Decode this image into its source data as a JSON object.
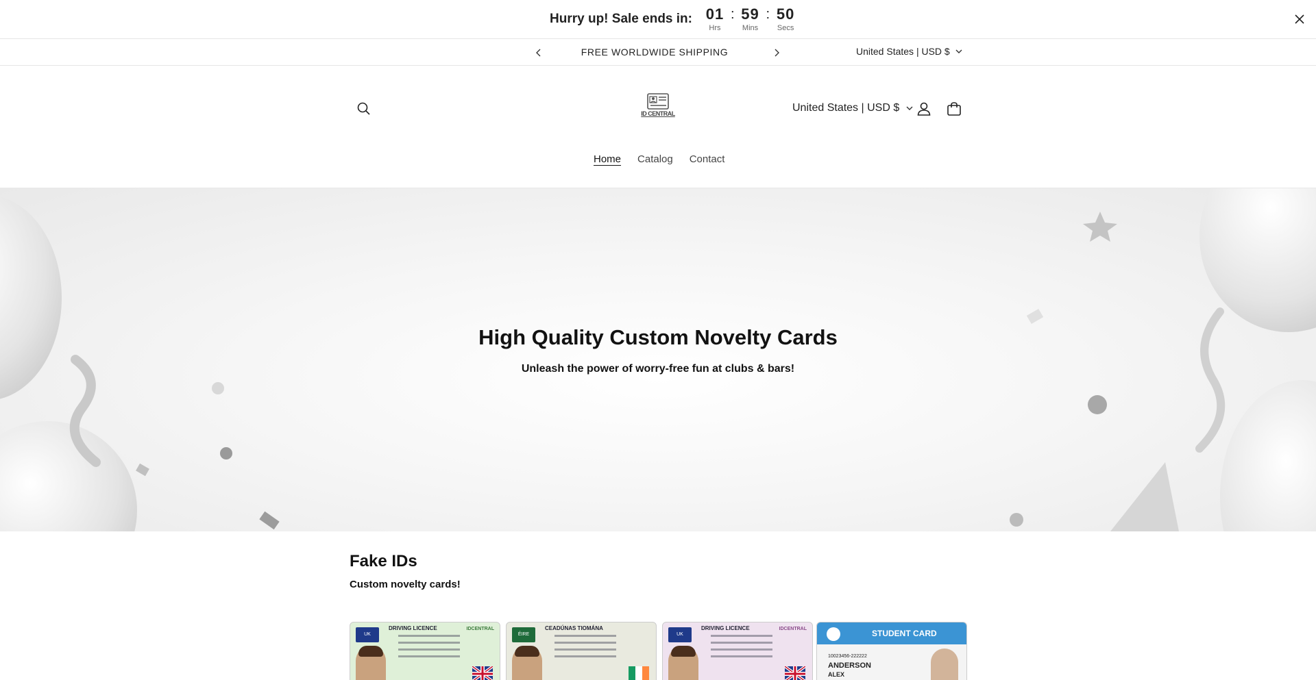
{
  "countdown": {
    "label": "Hurry up! Sale ends in:",
    "hours": "01",
    "hours_caption": "Hrs",
    "minutes": "59",
    "minutes_caption": "Mins",
    "seconds": "50",
    "seconds_caption": "Secs",
    "separator": ":"
  },
  "announcement": {
    "text": "FREE WORLDWIDE SHIPPING",
    "locale": "United States | USD $"
  },
  "header": {
    "logo_text": "ID CENTRAL",
    "locale": "United States | USD $",
    "nav": [
      {
        "label": "Home",
        "active": true
      },
      {
        "label": "Catalog",
        "active": false
      },
      {
        "label": "Contact",
        "active": false
      }
    ]
  },
  "hero": {
    "title": "High Quality Custom Novelty Cards",
    "subtitle": "Unleash the power of worry-free fun at clubs & bars!"
  },
  "collection": {
    "title": "Fake IDs",
    "subtitle": "Custom novelty cards!",
    "products": [
      {
        "card_title": "DRIVING LICENCE",
        "badge": "UK",
        "brand": "IDCENTRAL",
        "theme": "#dff0d8",
        "flag": "uk"
      },
      {
        "card_title": "CEADÚNAS TIOMÁNA",
        "badge": "ÉIRE",
        "brand": "",
        "theme": "#e9eadf",
        "flag": "ireland"
      },
      {
        "card_title": "DRIVING LICENCE",
        "badge": "UK",
        "brand": "IDCENTRAL",
        "theme": "#efe2ef",
        "flag": "uk"
      },
      {
        "card_title": "STUDENT CARD",
        "badge": "",
        "brand": "",
        "theme": "#3b94d4",
        "flag": "none",
        "student_id": "10023456-222222",
        "surname": "ANDERSON",
        "given_name": "ALEX"
      }
    ]
  },
  "colors": {
    "accent": "#121212",
    "student_blue": "#3b94d4"
  }
}
